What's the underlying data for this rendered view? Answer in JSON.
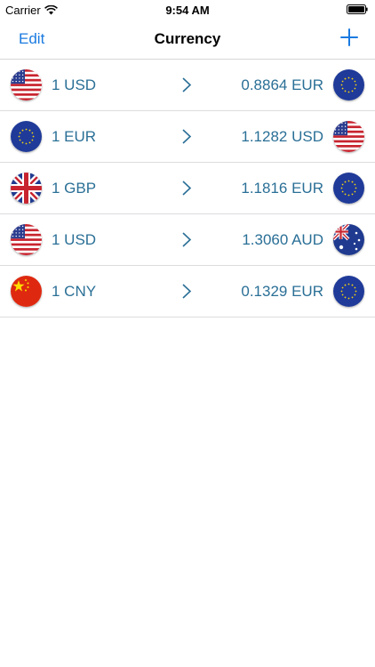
{
  "status_bar": {
    "carrier": "Carrier",
    "time": "9:54 AM"
  },
  "nav": {
    "edit_label": "Edit",
    "title": "Currency",
    "add_icon": "plus-icon"
  },
  "accent_color": "#1a7ae0",
  "text_color": "#2a6f96",
  "rows": [
    {
      "from_flag": "us",
      "from": "1 USD",
      "to": "0.8864 EUR",
      "to_flag": "eu"
    },
    {
      "from_flag": "eu",
      "from": "1 EUR",
      "to": "1.1282 USD",
      "to_flag": "us"
    },
    {
      "from_flag": "gb",
      "from": "1 GBP",
      "to": "1.1816 EUR",
      "to_flag": "eu"
    },
    {
      "from_flag": "us",
      "from": "1 USD",
      "to": "1.3060 AUD",
      "to_flag": "au"
    },
    {
      "from_flag": "cn",
      "from": "1 CNY",
      "to": "0.1329 EUR",
      "to_flag": "eu"
    }
  ]
}
